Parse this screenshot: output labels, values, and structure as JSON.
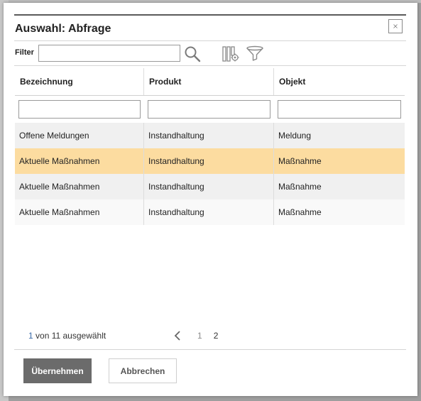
{
  "dialog": {
    "title": "Auswahl: Abfrage",
    "close_icon": "close-icon"
  },
  "filter": {
    "label": "Filter",
    "value": "",
    "placeholder": "",
    "icons": [
      "search-icon",
      "column-settings-icon",
      "funnel-icon"
    ]
  },
  "table": {
    "columns": [
      "Bezeichnung",
      "Produkt",
      "Objekt"
    ],
    "column_filters": [
      "",
      "",
      ""
    ],
    "rows": [
      {
        "bezeichnung": "Offene Meldungen",
        "produkt": "Instandhaltung",
        "objekt": "Meldung"
      },
      {
        "bezeichnung": "Aktuelle Maßnahmen",
        "produkt": "Instandhaltung",
        "objekt": "Maßnahme"
      },
      {
        "bezeichnung": "Aktuelle Maßnahmen",
        "produkt": "Instandhaltung",
        "objekt": "Maßnahme"
      },
      {
        "bezeichnung": "Aktuelle Maßnahmen",
        "produkt": "Instandhaltung",
        "objekt": "Maßnahme"
      }
    ],
    "selected_row_index": 1
  },
  "footer": {
    "selected_count": "1",
    "selection_text": "von 11 ausgewählt",
    "pages": [
      "1",
      "2"
    ],
    "active_page": "2",
    "prev_icon": "chevron-left-icon"
  },
  "buttons": {
    "apply": "Übernehmen",
    "cancel": "Abbrechen"
  },
  "colors": {
    "selected_row": "#fcdca0",
    "primary_button": "#6b6b6b",
    "title_rule": "#5a5a5a"
  }
}
